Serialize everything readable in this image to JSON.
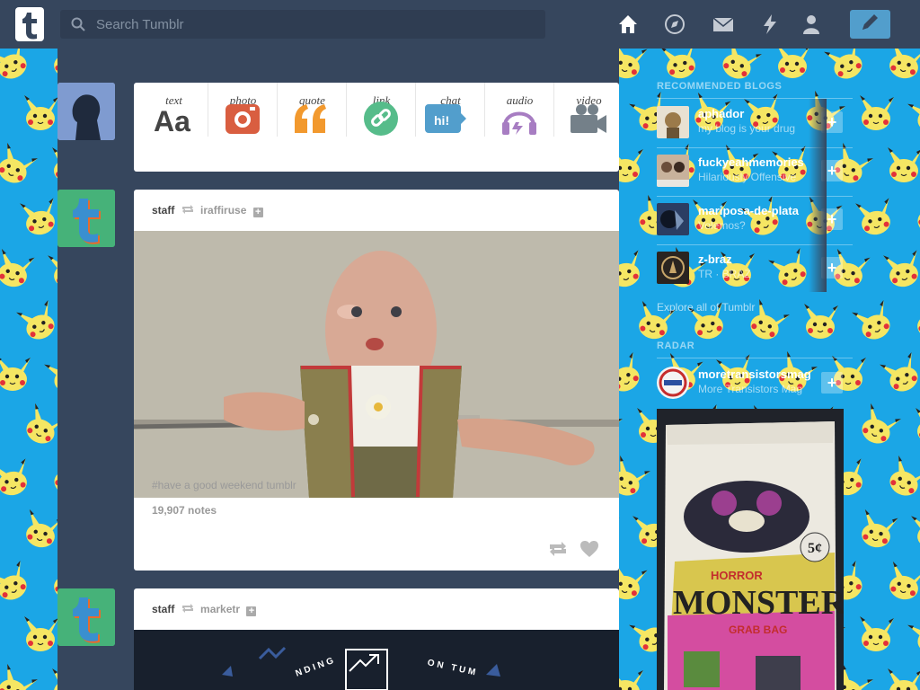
{
  "header": {
    "search_placeholder": "Search Tumblr",
    "nav_icons": [
      "home-icon",
      "explore-icon",
      "inbox-icon",
      "activity-icon",
      "account-icon"
    ],
    "compose_icon": "pencil-icon"
  },
  "post_bar": {
    "items": [
      {
        "label": "text",
        "icon": "text-icon"
      },
      {
        "label": "photo",
        "icon": "camera-icon"
      },
      {
        "label": "quote",
        "icon": "quote-icon"
      },
      {
        "label": "link",
        "icon": "link-icon"
      },
      {
        "label": "chat",
        "icon": "chat-icon"
      },
      {
        "label": "audio",
        "icon": "headphones-icon"
      },
      {
        "label": "video",
        "icon": "video-camera-icon"
      }
    ]
  },
  "posts": [
    {
      "author": "staff",
      "reblogged_from": "iraffiruse",
      "tags": "#have a good weekend tumblr",
      "notes": "19,907 notes"
    },
    {
      "author": "staff",
      "reblogged_from": "marketr",
      "image_text_left": "NDING",
      "image_text_right": "ON TUM"
    }
  ],
  "sidebar": {
    "recommended_title": "RECOMMENDED BLOGS",
    "recommended": [
      {
        "name": "aphador",
        "subtitle": "my blog is your drug"
      },
      {
        "name": "fuckyeahmemories",
        "subtitle": "Hilariously Offensive"
      },
      {
        "name": "mariposa-de-plata",
        "subtitle": "Volemos?"
      },
      {
        "name": "z-braz",
        "subtitle": "TR · BRAZ"
      }
    ],
    "explore_link": "Explore all of Tumblr",
    "radar_title": "RADAR",
    "radar": {
      "name": "moretransistorsmag",
      "subtitle": "More Transistors Mag"
    },
    "radar_image_text": {
      "price": "5¢",
      "line1": "HORROR",
      "line2": "MONSTERS",
      "line3": "GRAB BAG"
    }
  },
  "colors": {
    "header_bg": "#36465d",
    "compose_bg": "#529ecc",
    "background_blue": "#1ba6e6"
  }
}
